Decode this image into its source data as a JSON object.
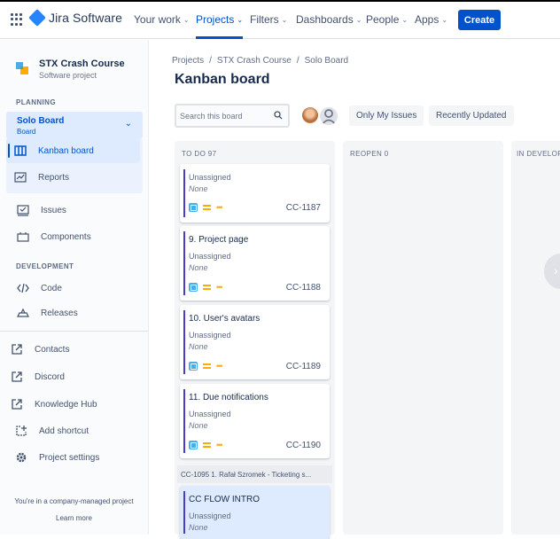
{
  "topnav": {
    "product": "Jira Software",
    "items": [
      {
        "label": "Your work"
      },
      {
        "label": "Projects"
      },
      {
        "label": "Filters"
      },
      {
        "label": "Dashboards"
      },
      {
        "label": "People"
      },
      {
        "label": "Apps"
      }
    ],
    "create_label": "Create",
    "caret": "⌄"
  },
  "sidebar": {
    "project_name": "STX Crash Course",
    "project_type": "Software project",
    "planning_heading": "PLANNING",
    "board_name": "Solo Board",
    "board_sub": "Board",
    "planning_items": [
      {
        "label": "Kanban board",
        "icon": "board-icon"
      },
      {
        "label": "Reports",
        "icon": "chart-icon"
      },
      {
        "label": "Issues",
        "icon": "issues-icon"
      },
      {
        "label": "Components",
        "icon": "components-icon"
      }
    ],
    "development_heading": "DEVELOPMENT",
    "development_items": [
      {
        "label": "Code",
        "icon": "code-icon"
      },
      {
        "label": "Releases",
        "icon": "releases-icon"
      }
    ],
    "shortcut_items": [
      {
        "label": "Contacts",
        "icon": "external-link-icon"
      },
      {
        "label": "Discord",
        "icon": "external-link-icon"
      },
      {
        "label": "Knowledge Hub",
        "icon": "external-link-icon"
      },
      {
        "label": "Add shortcut",
        "icon": "add-shortcut-icon"
      },
      {
        "label": "Project settings",
        "icon": "gear-icon"
      }
    ],
    "footer_text": "You're in a company-managed project",
    "learn_more": "Learn more"
  },
  "main": {
    "breadcrumb": [
      "Projects",
      "STX Crash Course",
      "Solo Board"
    ],
    "breadcrumb_sep": "/",
    "title": "Kanban board",
    "search_placeholder": "Search this board",
    "filters": [
      "Only My Issues",
      "Recently Updated"
    ],
    "columns": [
      {
        "label": "TO DO 97"
      },
      {
        "label": "REOPEN 0"
      },
      {
        "label": "IN DEVELOP"
      }
    ],
    "cards": [
      {
        "title": "",
        "assignee": "Unassigned",
        "none": "None",
        "key": "CC-1187"
      },
      {
        "title": "9. Project page",
        "assignee": "Unassigned",
        "none": "None",
        "key": "CC-1188"
      },
      {
        "title": "10. User's avatars",
        "assignee": "Unassigned",
        "none": "None",
        "key": "CC-1189"
      },
      {
        "title": "11. Due notifications",
        "assignee": "Unassigned",
        "none": "None",
        "key": "CC-1190"
      }
    ],
    "group_header": "CC-1095 1. Rafał Szromek - Ticketing s...",
    "group_card": {
      "title": "CC FLOW INTRO",
      "assignee": "Unassigned",
      "none": "None"
    }
  },
  "colors": {
    "accent": "#0052CC",
    "epic_bar": "#4C3BC4",
    "story": "#4BADE8",
    "priority": "#FFAB00"
  }
}
